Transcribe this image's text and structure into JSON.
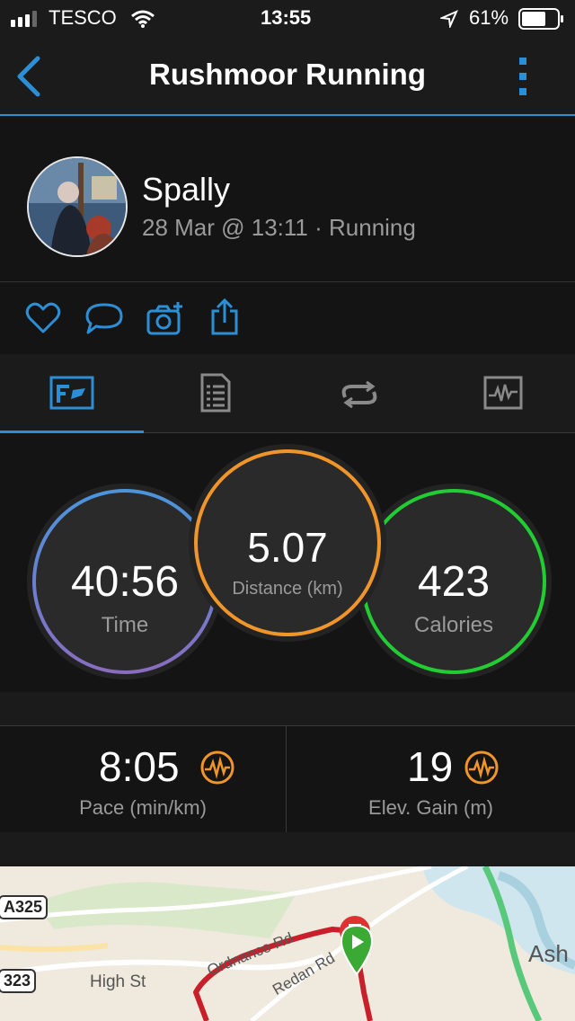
{
  "status": {
    "carrier": "TESCO",
    "time": "13:55",
    "battery": "61%"
  },
  "header": {
    "title": "Rushmoor Running"
  },
  "activity": {
    "user": "Spally",
    "subtitle": "28 Mar @ 13:11 · Running"
  },
  "actions": [
    "heart-icon",
    "comment-icon",
    "add-photo-icon",
    "share-icon"
  ],
  "tabs": [
    "stats-tab",
    "details-tab",
    "laps-tab",
    "charts-tab"
  ],
  "stats": {
    "time": {
      "value": "40:56",
      "label": "Time"
    },
    "distance": {
      "value": "5.07",
      "label": "Distance (km)"
    },
    "calories": {
      "value": "423",
      "label": "Calories"
    }
  },
  "metrics": {
    "pace": {
      "value": "8:05",
      "label": "Pace (min/km)"
    },
    "elev": {
      "value": "19",
      "label": "Elev. Gain (m)"
    }
  },
  "map": {
    "roads": [
      "A325",
      "323"
    ],
    "labels": [
      "High St",
      "Ordnance Rd",
      "Redan Rd",
      "Ash"
    ]
  },
  "colors": {
    "accent": "#2c8fd6",
    "time_ring": "#4a8fd8",
    "distance_ring": "#f0952a",
    "calories_ring": "#22cc33",
    "metric_icon": "#f0952a"
  }
}
